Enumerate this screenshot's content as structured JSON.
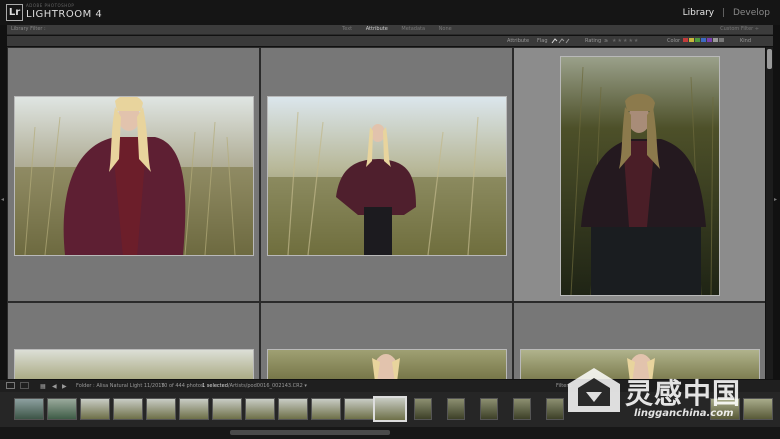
{
  "app": {
    "logo": "Lr",
    "product_sub": "ADOBE PHOTOSHOP",
    "product_name": "LIGHTROOM 4"
  },
  "modules": [
    {
      "label": "Library",
      "active": true
    },
    {
      "label": "Develop",
      "active": false
    }
  ],
  "module_sep": "|",
  "library_filter": {
    "title": "Library Filter :",
    "tabs": [
      {
        "label": "Text",
        "selected": false
      },
      {
        "label": "Attribute",
        "selected": true
      },
      {
        "label": "Metadata",
        "selected": false
      },
      {
        "label": "None",
        "selected": false
      }
    ],
    "custom": "Custom Filter ÷"
  },
  "attribute_bar": {
    "attribute_label": "Attribute",
    "flag_label": "Flag",
    "rating_label": "Rating",
    "rating_op": "≥",
    "color_label": "Color",
    "kind_label": "Kind",
    "colors": [
      "#c23b3b",
      "#c8b73a",
      "#4d9a3d",
      "#3d6ac2",
      "#7b3fb0",
      "#999999",
      "#777777"
    ]
  },
  "filmstrip_toolbar": {
    "source": "Folder : Alisa Natural Light 11/2015",
    "count": "70 of 444 photos",
    "selected": "1 selected",
    "filename": "/Artists/pod0016_002143.CR2 ▾",
    "filter_label": "Filter :"
  },
  "watermark": {
    "chinese": "灵感中国",
    "url": "lingganchina.com"
  },
  "colors": {
    "grid_cell": "#777777",
    "selected_cell": "#8c8c8c",
    "frame": "#2a2a2a"
  }
}
